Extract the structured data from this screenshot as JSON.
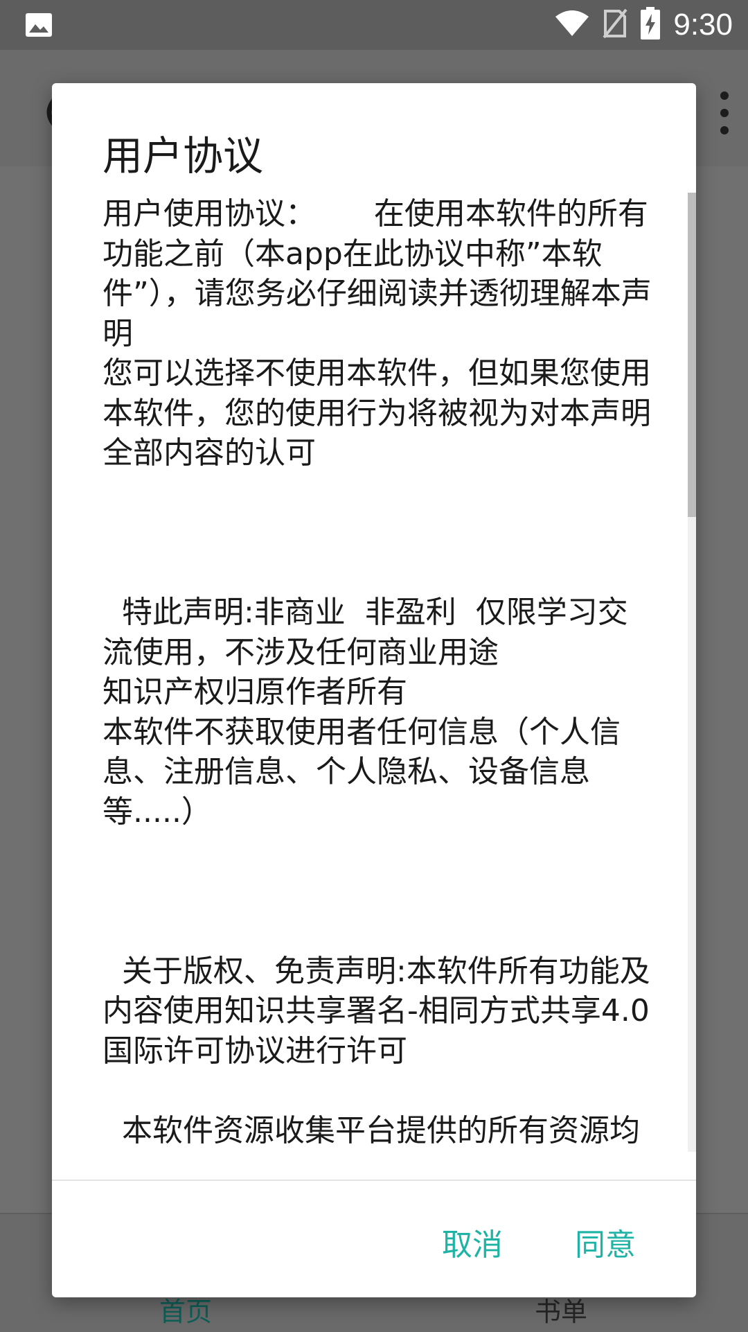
{
  "status_bar": {
    "time": "9:30",
    "icons": [
      "image-icon",
      "wifi-icon",
      "no-sim-icon",
      "battery-charging-icon"
    ]
  },
  "background_app": {
    "menu_icon": "more-vert-icon",
    "nav": {
      "home": "首页",
      "books": "书单"
    }
  },
  "dialog": {
    "title": "用户协议",
    "body": "用户使用协议：      在使用本软件的所有功能之前（本app在此协议中称”本软件”），请您务必仔细阅读并透彻理解本声明\n您可以选择不使用本软件，但如果您使用本软件，您的使用行为将被视为对本声明全部内容的认可\n\n\n\n  特此声明:非商业  非盈利  仅限学习交流使用，不涉及任何商业用途\n知识产权归原作者所有\n本软件不获取使用者任何信息（个人信息、注册信息、个人隐私、设备信息等.....）\n\n\n\n  关于版权、免责声明:本软件所有功能及内容使用知识共享署名-相同方式共享4.0国际许可协议进行许可\n\n  本软件资源收集平台提供的所有资源均系收集于互联网及各大网站，软件内只提供web页面及官方网址服",
    "cancel_label": "取消",
    "agree_label": "同意",
    "accent_color": "#1fb3a6"
  }
}
